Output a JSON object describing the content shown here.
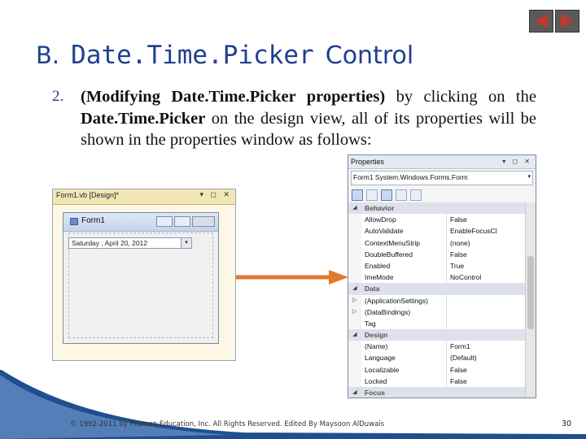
{
  "title": {
    "letter": "B.",
    "code_part": "Date.Time.Picker",
    "plain_part": "Control"
  },
  "item": {
    "number": "2.",
    "bold_text": "(Modifying Date.Time.Picker properties)",
    "text_1": " by clicking on the ",
    "bold_text_2": "Date.Time.Picker",
    "text_2": " on the design view, all of its properties will be shown in the properties window as follows:"
  },
  "designer": {
    "tab_label": "Form1.vb [Design]*",
    "window_controls": "▾ ◻ ✕",
    "form_title": "Form1",
    "picker_value": "Saturday ,     April     20, 2012",
    "picker_drop": "▾"
  },
  "properties": {
    "title": "Properties",
    "title_icons": "▾ ◻ ✕",
    "object": "Form1 System.Windows.Forms.Form",
    "rows": [
      {
        "type": "cat",
        "name": "Behavior",
        "value": "",
        "gutter": "◢"
      },
      {
        "type": "prop",
        "name": "AllowDrop",
        "value": "False",
        "gutter": ""
      },
      {
        "type": "prop",
        "name": "AutoValidate",
        "value": "EnableFocusCl",
        "gutter": ""
      },
      {
        "type": "prop",
        "name": "ContextMenuStrip",
        "value": "(none)",
        "gutter": ""
      },
      {
        "type": "prop",
        "name": "DoubleBuffered",
        "value": "False",
        "gutter": ""
      },
      {
        "type": "prop",
        "name": "Enabled",
        "value": "True",
        "gutter": ""
      },
      {
        "type": "prop",
        "name": "ImeMode",
        "value": "NoControl",
        "gutter": ""
      },
      {
        "type": "cat",
        "name": "Data",
        "value": "",
        "gutter": "◢"
      },
      {
        "type": "prop",
        "name": "(ApplicationSettings)",
        "value": "",
        "gutter": "▷"
      },
      {
        "type": "prop",
        "name": "(DataBindings)",
        "value": "",
        "gutter": "▷"
      },
      {
        "type": "prop",
        "name": "Tag",
        "value": "",
        "gutter": ""
      },
      {
        "type": "cat",
        "name": "Design",
        "value": "",
        "gutter": "◢"
      },
      {
        "type": "prop",
        "name": "(Name)",
        "value": "Form1",
        "gutter": ""
      },
      {
        "type": "prop",
        "name": "Language",
        "value": "(Default)",
        "gutter": ""
      },
      {
        "type": "prop",
        "name": "Localizable",
        "value": "False",
        "gutter": ""
      },
      {
        "type": "prop",
        "name": "Locked",
        "value": "False",
        "gutter": ""
      },
      {
        "type": "cat",
        "name": "Focus",
        "value": "",
        "gutter": "◢"
      }
    ]
  },
  "footer": "© 1992-2011 by Pearson Education, Inc. All Rights Reserved. Edited By Maysoon AlDuwais",
  "page_number": "30",
  "colors": {
    "title": "#1f3f8f",
    "arrow": "#e07a2f",
    "nav": "#5a5a5a",
    "nav_arrow": "#c0392b"
  }
}
